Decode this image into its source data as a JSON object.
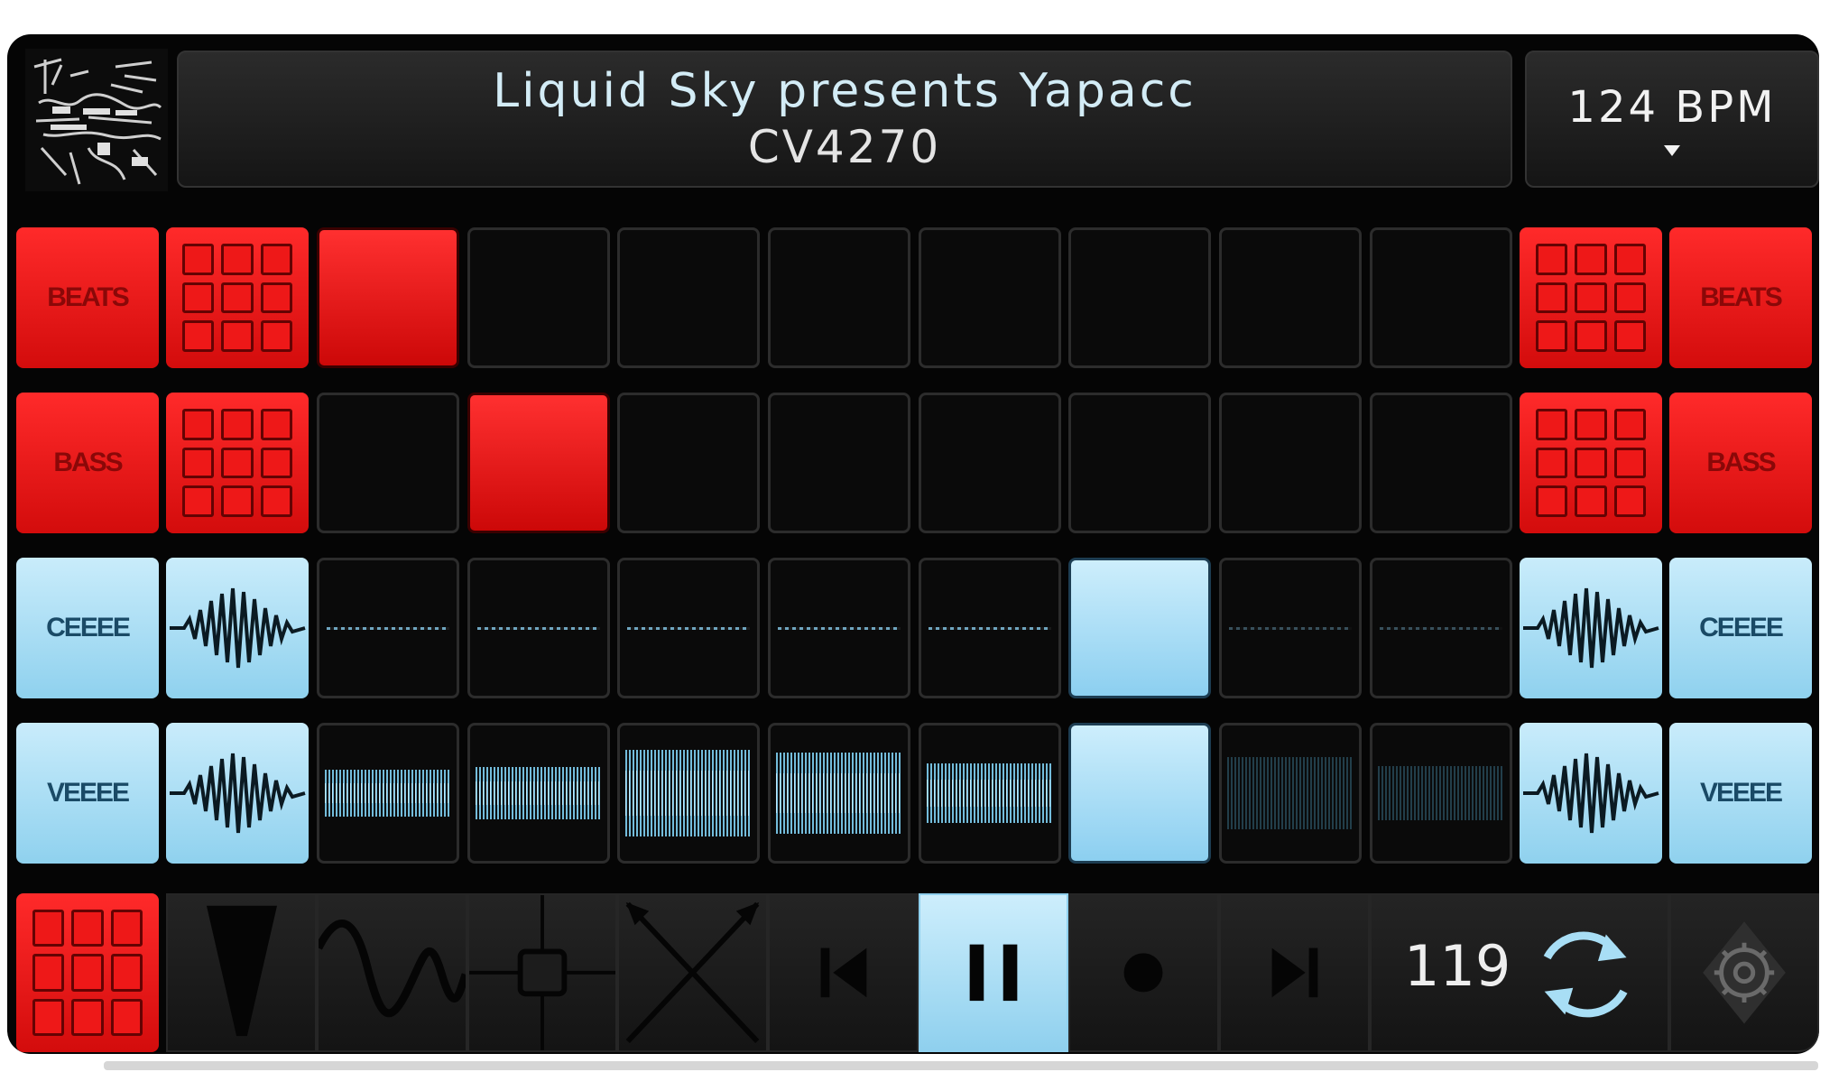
{
  "header": {
    "title_line1": "Liquid Sky presents Yapacc",
    "title_line2": "CV4270",
    "bpm": "124 BPM"
  },
  "rows": [
    {
      "label": "BEATS",
      "color": "red",
      "active_clip": 0,
      "clips": 8
    },
    {
      "label": "BASS",
      "color": "red",
      "active_clip": 1,
      "clips": 8
    },
    {
      "label": "CEEEE",
      "color": "blue",
      "active_clip": 5,
      "clips": 8
    },
    {
      "label": "VEEEE",
      "color": "blue",
      "active_clip": 5,
      "clips": 8
    }
  ],
  "colors": {
    "red": "#e81414",
    "blue": "#a8def5",
    "background": "#050505"
  },
  "toolbar": {
    "items": [
      "grid-icon",
      "filter-icon",
      "wave-icon",
      "xy-pad-icon",
      "crossfader-icon",
      "previous-icon",
      "pause-icon",
      "record-icon",
      "next-icon",
      "counter",
      "loop-icon",
      "settings-icon"
    ],
    "counter": "119"
  }
}
